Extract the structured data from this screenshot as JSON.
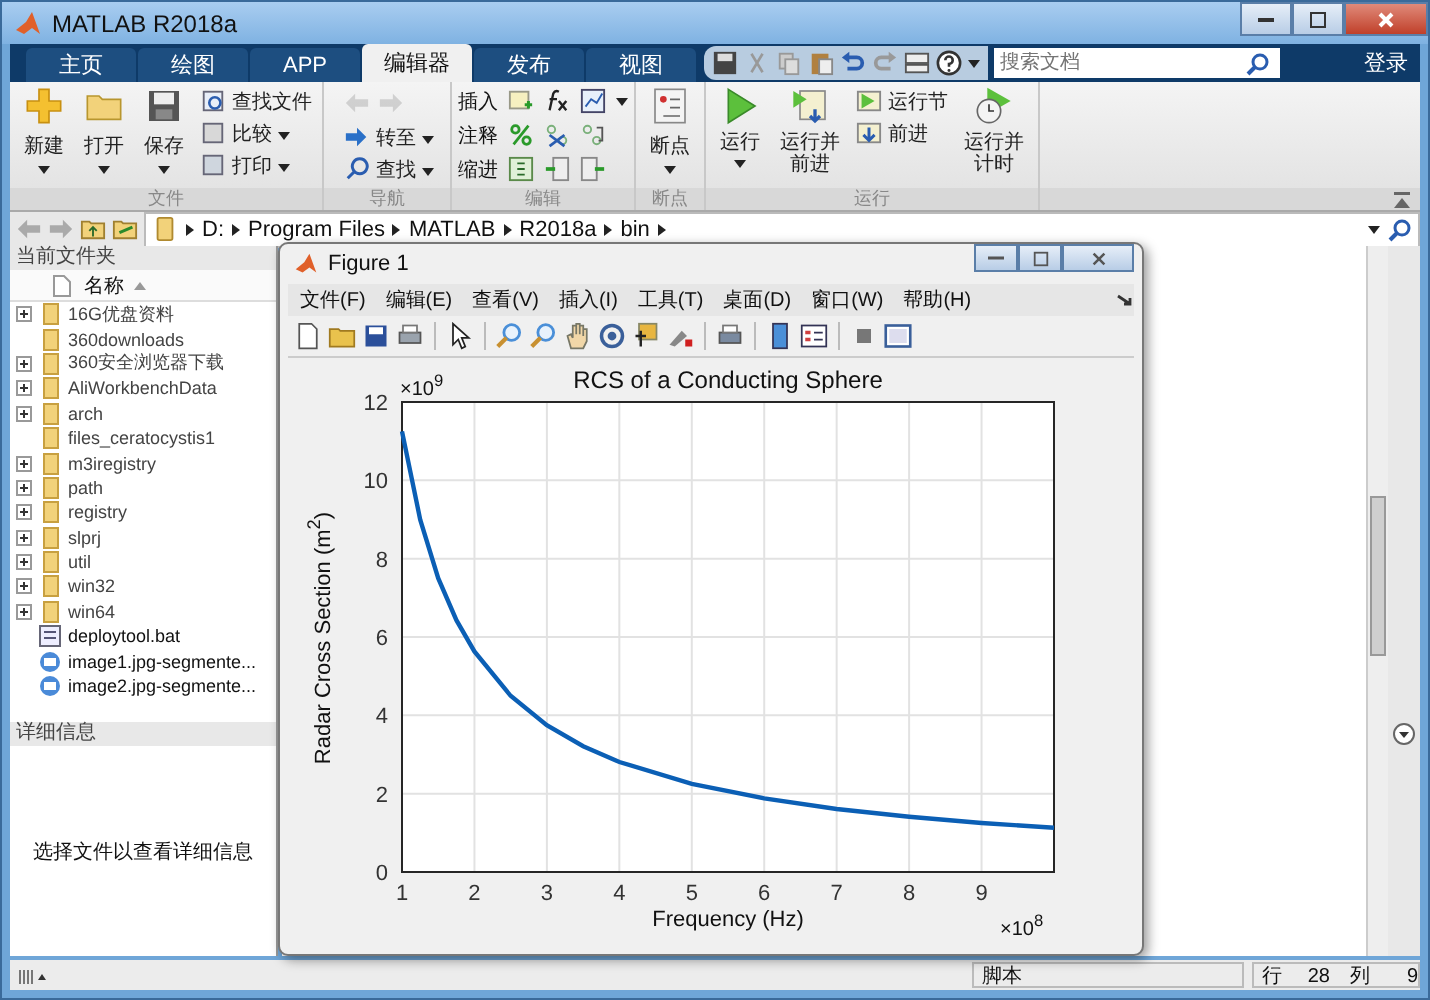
{
  "window": {
    "title": "MATLAB R2018a"
  },
  "tabs": [
    {
      "label": "主页",
      "selected": false
    },
    {
      "label": "绘图",
      "selected": false
    },
    {
      "label": "APP",
      "selected": false
    },
    {
      "label": "编辑器",
      "selected": true
    },
    {
      "label": "发布",
      "selected": false
    },
    {
      "label": "视图",
      "selected": false
    }
  ],
  "search": {
    "placeholder": "搜索文档"
  },
  "login_button": "登录",
  "ribbon": {
    "file": {
      "label": "文件",
      "large": [
        {
          "label": "新建",
          "dropdown": true
        },
        {
          "label": "打开",
          "dropdown": true
        },
        {
          "label": "保存",
          "dropdown": true
        }
      ],
      "small": [
        {
          "label": "查找文件",
          "dropdown": false
        },
        {
          "label": "比较",
          "dropdown": true
        },
        {
          "label": "打印",
          "dropdown": true
        }
      ]
    },
    "navigate": {
      "label": "导航",
      "small": [
        {
          "label": "转至",
          "dropdown": true
        },
        {
          "label": "查找",
          "dropdown": true
        }
      ]
    },
    "edit": {
      "label": "编辑",
      "rows": [
        "插入",
        "注释",
        "缩进"
      ]
    },
    "breakpoints": {
      "label": "断点",
      "large": [
        {
          "label": "断点",
          "dropdown": true
        }
      ]
    },
    "run": {
      "label": "运行",
      "large": [
        {
          "label": "运行",
          "dropdown": true
        },
        {
          "label": "运行并前进",
          "dropdown": false
        }
      ],
      "small": [
        {
          "label": "运行节"
        },
        {
          "label": "前进"
        }
      ],
      "large_end": [
        {
          "label": "运行并计时",
          "dropdown": false
        }
      ]
    }
  },
  "address": {
    "path": [
      "D:",
      "Program Files",
      "MATLAB",
      "R2018a",
      "bin"
    ]
  },
  "current_folder": {
    "title": "当前文件夹",
    "column": "名称",
    "files": [
      {
        "name": "16G优盘资料",
        "kind": "folder",
        "expandable": true
      },
      {
        "name": "360downloads",
        "kind": "folder",
        "expandable": false
      },
      {
        "name": "360安全浏览器下载",
        "kind": "folder",
        "expandable": true
      },
      {
        "name": "AliWorkbenchData",
        "kind": "folder",
        "expandable": true
      },
      {
        "name": "arch",
        "kind": "folder",
        "expandable": true
      },
      {
        "name": "files_ceratocystis1",
        "kind": "folder",
        "expandable": false
      },
      {
        "name": "m3iregistry",
        "kind": "folder",
        "expandable": true
      },
      {
        "name": "path",
        "kind": "folder",
        "expandable": true
      },
      {
        "name": "registry",
        "kind": "folder",
        "expandable": true
      },
      {
        "name": "slprj",
        "kind": "folder",
        "expandable": true
      },
      {
        "name": "util",
        "kind": "folder",
        "expandable": true
      },
      {
        "name": "win32",
        "kind": "folder",
        "expandable": true
      },
      {
        "name": "win64",
        "kind": "folder",
        "expandable": true
      },
      {
        "name": "deploytool.bat",
        "kind": "batch",
        "expandable": false
      },
      {
        "name": "image1.jpg-segmente...",
        "kind": "image",
        "expandable": false
      },
      {
        "name": "image2.jpg-segmente...",
        "kind": "image",
        "expandable": false
      }
    ]
  },
  "details": {
    "title": "详细信息",
    "message": "选择文件以查看详细信息"
  },
  "figure": {
    "title": "Figure 1",
    "menu": [
      "文件(F)",
      "编辑(E)",
      "查看(V)",
      "插入(I)",
      "工具(T)",
      "桌面(D)",
      "窗口(W)",
      "帮助(H)"
    ],
    "chart_data": {
      "type": "line",
      "title": "RCS of a Conducting Sphere",
      "xlabel": "Frequency (Hz)",
      "ylabel": "Radar Cross Section (m$^{2}$)",
      "x": [
        1,
        1.25,
        1.5,
        1.75,
        2,
        2.5,
        3,
        3.5,
        4,
        5,
        6,
        7,
        8,
        9,
        10
      ],
      "grid": true,
      "series": [
        {
          "color": "#0b5fb5",
          "values": [
            11.25,
            9,
            7.5,
            6.43,
            5.63,
            4.5,
            3.75,
            3.21,
            2.81,
            2.25,
            1.88,
            1.61,
            1.41,
            1.25,
            1.13
          ]
        }
      ],
      "xlim": [
        1,
        10
      ],
      "ylim": [
        0,
        12
      ],
      "xticks": [
        1,
        2,
        3,
        4,
        5,
        6,
        7,
        8,
        9
      ],
      "yticks": [
        0,
        2,
        4,
        6,
        8,
        10,
        12
      ],
      "annotations": [
        "×10$^{9}$",
        "×10$^{8}$"
      ]
    }
  },
  "status_bar": {
    "mode": "脚本",
    "line_label": "行",
    "line": "28",
    "col_label": "列",
    "col": "9"
  }
}
